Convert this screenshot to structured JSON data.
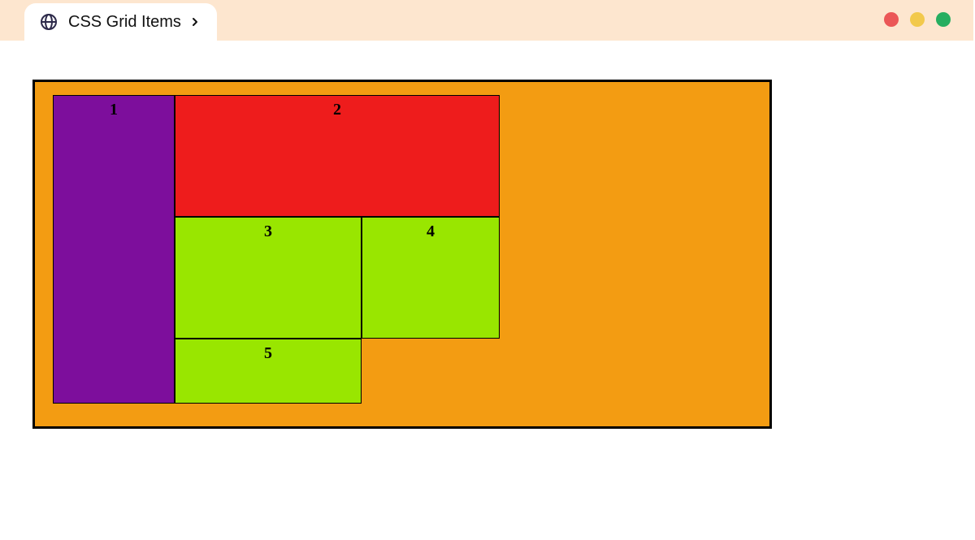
{
  "window": {
    "tab_title": "CSS Grid Items"
  },
  "colors": {
    "frame_bg": "#f39c12",
    "cell_default": "#99e600",
    "cell1_bg": "#7d0e9c",
    "cell2_bg": "#ee1c1c",
    "traffic_red": "#eb5757",
    "traffic_yellow": "#f2c94c",
    "traffic_green": "#27ae60"
  },
  "grid": {
    "cells": {
      "c1": {
        "label": "1",
        "bg_key": "cell1_bg"
      },
      "c2": {
        "label": "2",
        "bg_key": "cell2_bg"
      },
      "c3": {
        "label": "3",
        "bg_key": "cell_default"
      },
      "c4": {
        "label": "4",
        "bg_key": "cell_default"
      },
      "c5": {
        "label": "5",
        "bg_key": "cell_default"
      }
    }
  }
}
